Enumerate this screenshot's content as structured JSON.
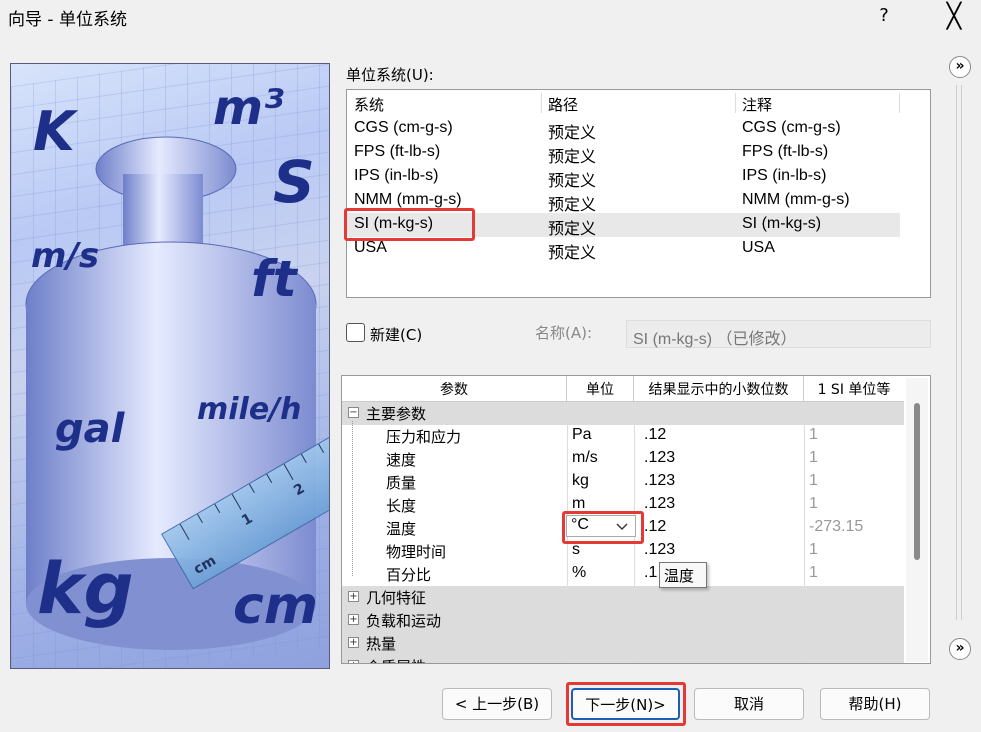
{
  "window": {
    "title": "向导 - 单位系统",
    "help": "?",
    "close": "╳"
  },
  "illustration": {
    "units": [
      "K",
      "m³",
      "S",
      "m/s",
      "ft",
      "gal",
      "mile/h",
      "kg",
      "cm"
    ],
    "ruler_numbers": [
      "1",
      "2",
      "3"
    ],
    "ruler_unit": "cm"
  },
  "unit_system": {
    "label": "单位系统(U):",
    "columns": [
      "系统",
      "路径",
      "注释"
    ],
    "rows": [
      {
        "system": "CGS (cm-g-s)",
        "path": "预定义",
        "note": "CGS (cm-g-s)"
      },
      {
        "system": "FPS (ft-lb-s)",
        "path": "预定义",
        "note": "FPS (ft-lb-s)"
      },
      {
        "system": "IPS (in-lb-s)",
        "path": "预定义",
        "note": "IPS (in-lb-s)"
      },
      {
        "system": "NMM (mm-g-s)",
        "path": "预定义",
        "note": "NMM (mm-g-s)"
      },
      {
        "system": "SI (m-kg-s)",
        "path": "预定义",
        "note": "SI (m-kg-s)"
      },
      {
        "system": "USA",
        "path": "预定义",
        "note": "USA"
      }
    ],
    "selected": "SI (m-kg-s)"
  },
  "new_checkbox": {
    "label": "新建(C)",
    "checked": false
  },
  "name_field": {
    "label": "名称(A):",
    "value": "SI (m-kg-s) （已修改）"
  },
  "params": {
    "columns": [
      "参数",
      "单位",
      "结果显示中的小数位数",
      "1 SI 单位等"
    ],
    "main_group": "主要参数",
    "rows": [
      {
        "name": "压力和应力",
        "unit": "Pa",
        "decimals": ".12",
        "si": "1"
      },
      {
        "name": "速度",
        "unit": "m/s",
        "decimals": ".123",
        "si": "1"
      },
      {
        "name": "质量",
        "unit": "kg",
        "decimals": ".123",
        "si": "1"
      },
      {
        "name": "长度",
        "unit": "m",
        "decimals": ".123",
        "si": "1"
      },
      {
        "name": "温度",
        "unit": "°C",
        "decimals": ".12",
        "si": "-273.15"
      },
      {
        "name": "物理时间",
        "unit": "s",
        "decimals": ".123",
        "si": "1"
      },
      {
        "name": "百分比",
        "unit": "%",
        "decimals": ".1",
        "si": "1"
      }
    ],
    "collapsed_groups": [
      "几何特征",
      "负载和运动",
      "热量",
      "介质属性"
    ],
    "tooltip": "温度"
  },
  "buttons": {
    "back": "< 上一步(B)",
    "next": "下一步(N)>",
    "cancel": "取消",
    "help": "帮助(H)"
  },
  "side": {
    "up": "»",
    "down": "»"
  }
}
